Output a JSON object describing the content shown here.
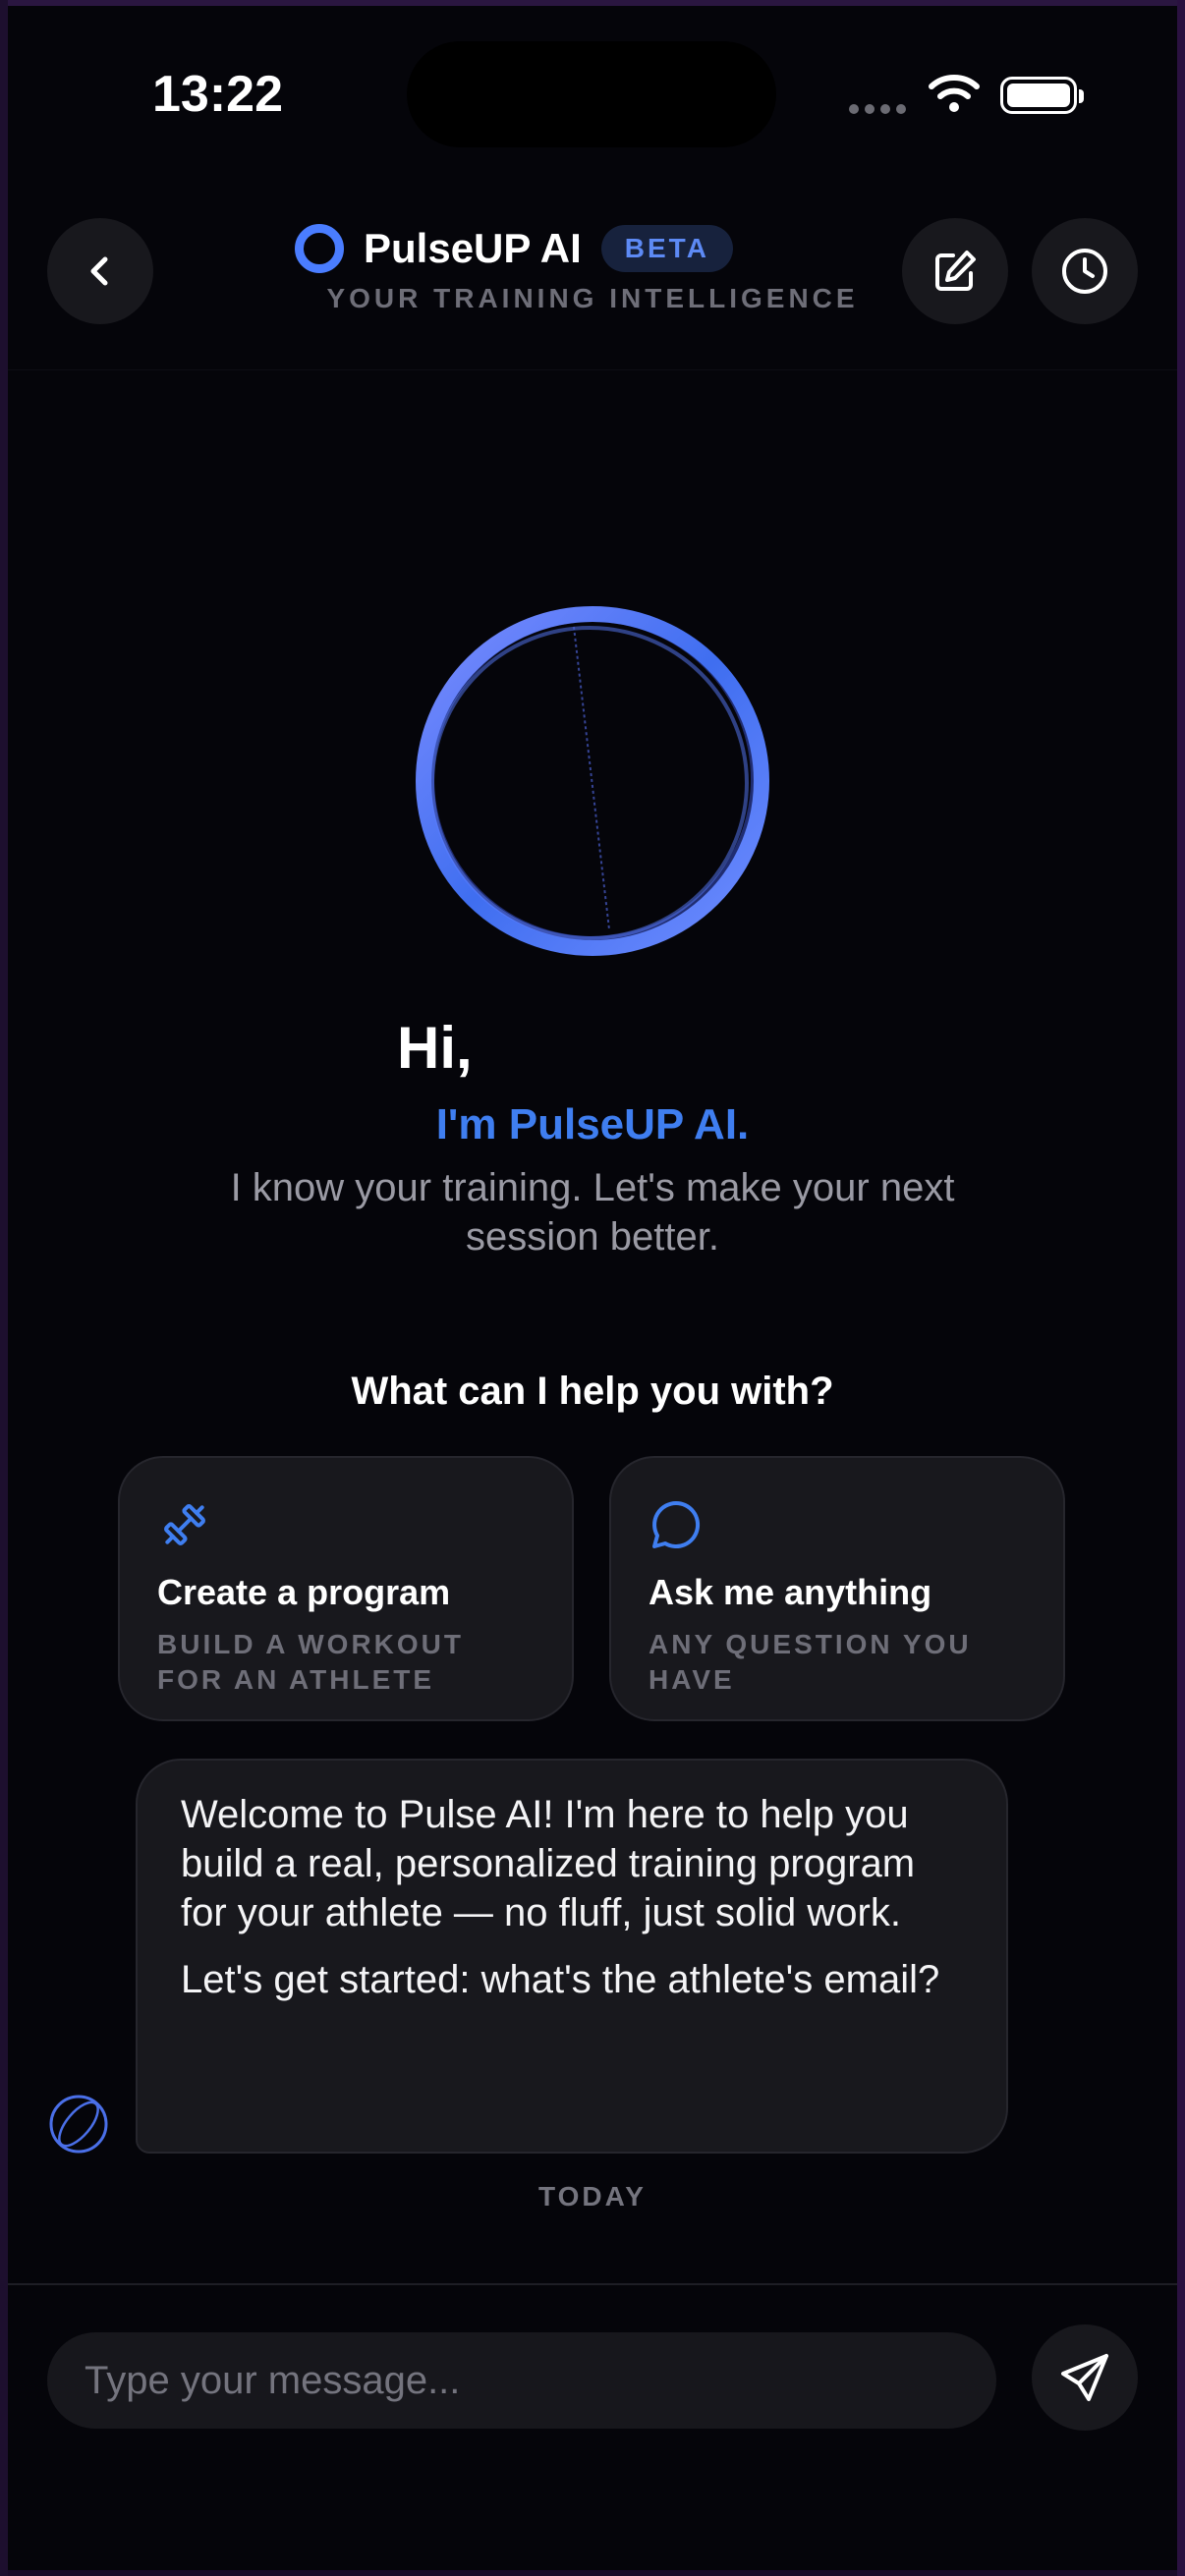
{
  "status_bar": {
    "time": "13:22"
  },
  "header": {
    "app_name": "PulseUP AI",
    "badge": "BETA",
    "tagline": "YOUR TRAINING INTELLIGENCE",
    "icons": {
      "back": "chevron-left-icon",
      "edit": "edit-icon",
      "history": "clock-icon"
    }
  },
  "hero": {
    "greeting": "Hi,",
    "intro": "I'm PulseUP AI.",
    "subtitle": "I know your training. Let's make your next session better."
  },
  "help": {
    "title": "What can I help you with?",
    "cards": [
      {
        "icon": "dumbbell-icon",
        "title": "Create a program",
        "subtitle": "BUILD A WORKOUT FOR AN ATHLETE"
      },
      {
        "icon": "chat-bubble-icon",
        "title": "Ask me anything",
        "subtitle": "ANY QUESTION YOU HAVE"
      }
    ]
  },
  "messages": [
    {
      "sender": "assistant",
      "paragraphs": [
        "Welcome to Pulse AI! I'm here to help you build a real, personalized training program for your athlete — no fluff, just solid work.",
        "Let's get started: what's the athlete's email?"
      ]
    }
  ],
  "day_label": "TODAY",
  "composer": {
    "placeholder": "Type your message...",
    "send_icon": "send-icon"
  },
  "colors": {
    "accent": "#4a7dff",
    "background": "#05050a",
    "card": "#18181d"
  }
}
